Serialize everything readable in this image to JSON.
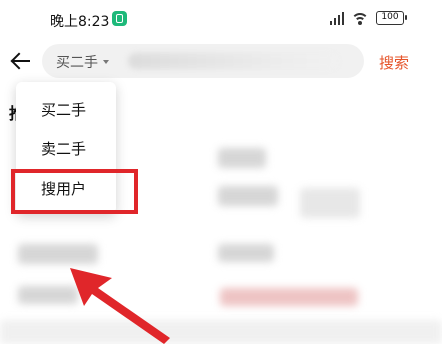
{
  "status_bar": {
    "time": "晚上8:23",
    "signal_icon": "signal-icon",
    "wifi_icon": "wifi-icon",
    "battery_level": "100"
  },
  "header": {
    "back_icon": "back-arrow-icon",
    "search_type": "买二手",
    "search_button": "搜索"
  },
  "section": {
    "title": "推"
  },
  "dropdown": {
    "items": [
      "买二手",
      "卖二手",
      "搜用户"
    ],
    "highlighted": "搜用户"
  },
  "annotation": {
    "highlight_color": "#e0262a",
    "arrow_color": "#e0262a"
  }
}
